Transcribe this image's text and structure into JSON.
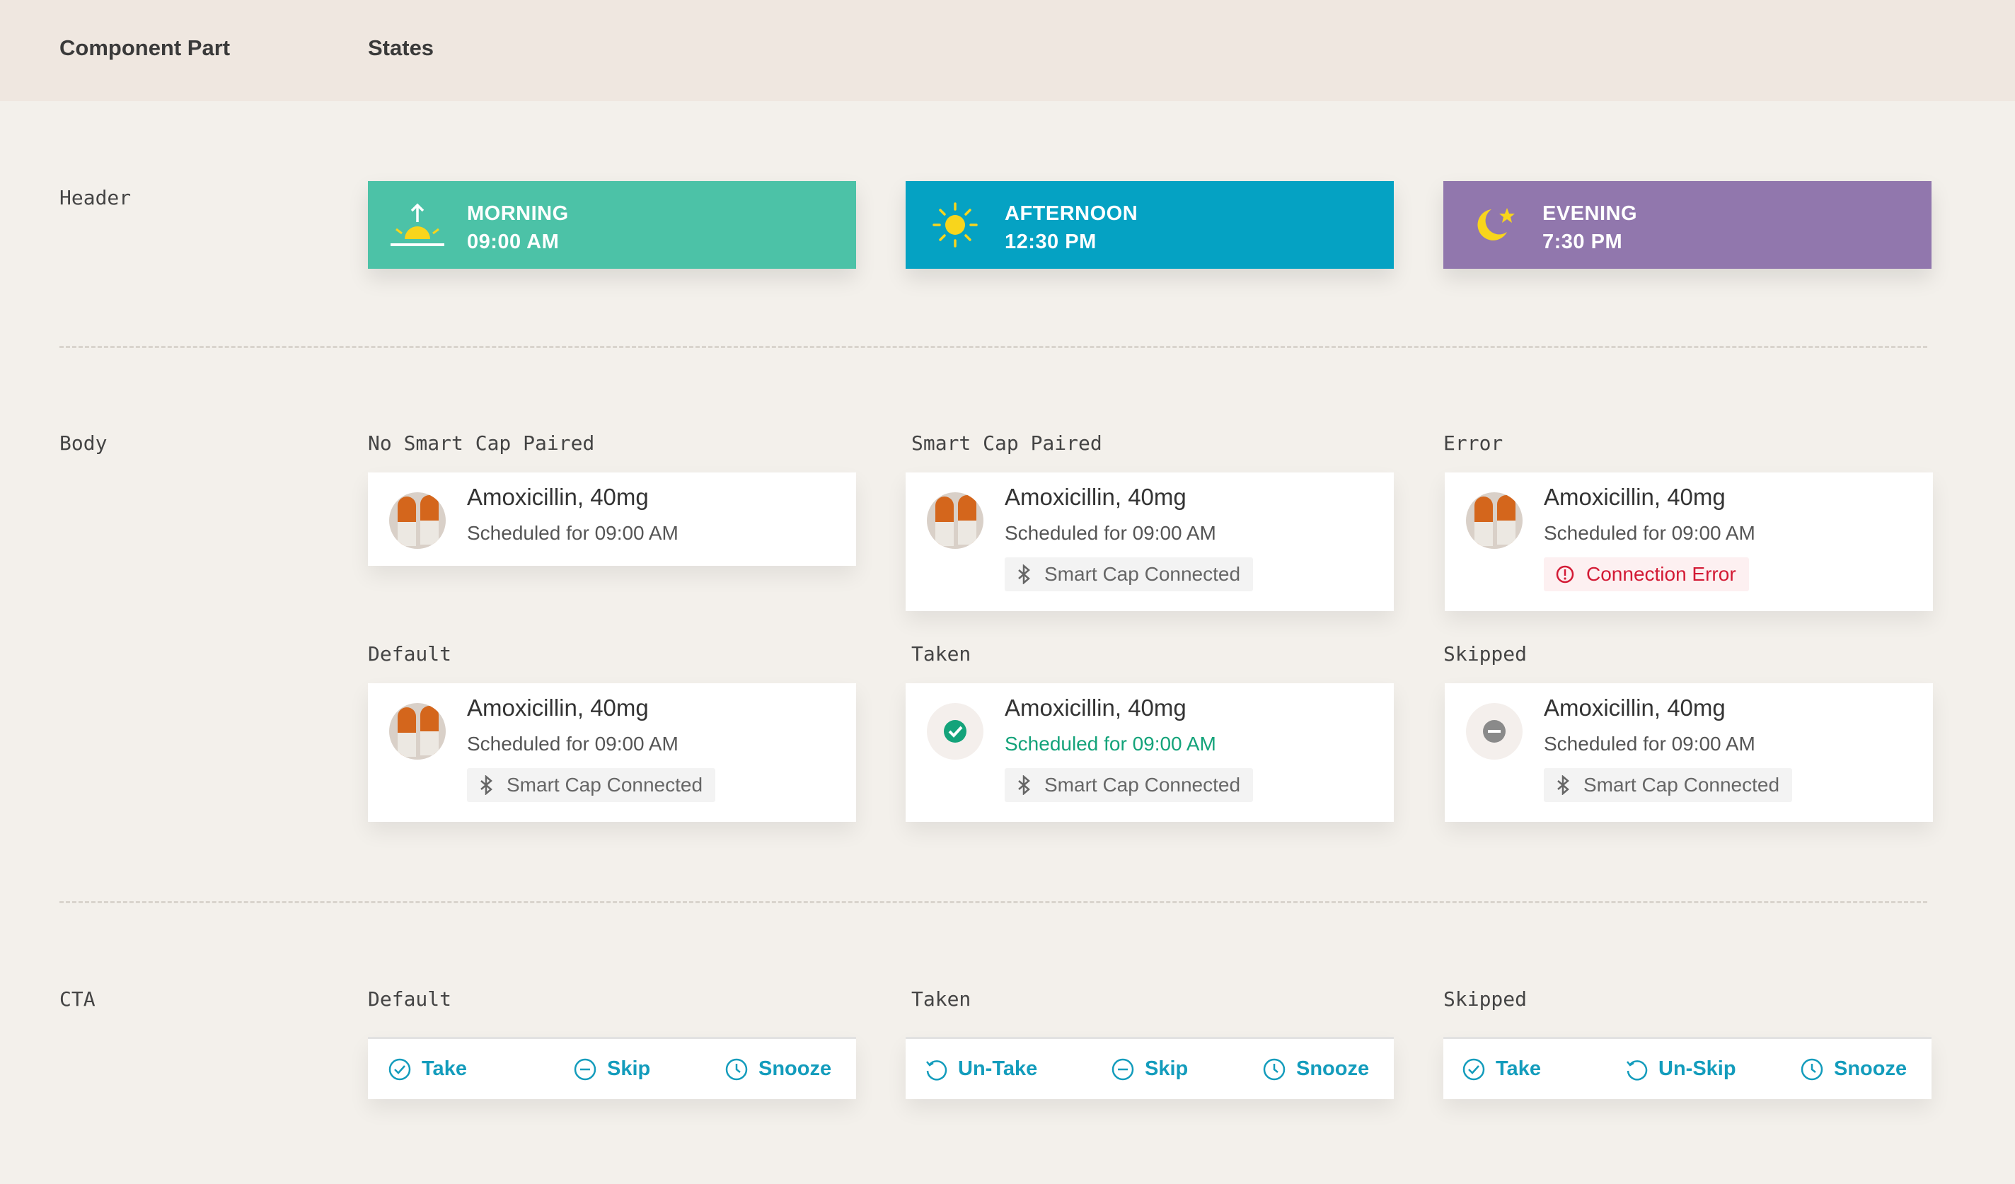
{
  "table_header": {
    "component_part": "Component Part",
    "states": "States"
  },
  "rows": {
    "header": "Header",
    "body": "Body",
    "cta": "CTA"
  },
  "header_states": [
    {
      "period": "MORNING",
      "time": "09:00 AM",
      "color": "#4cc2a7",
      "icon": "sunrise-icon"
    },
    {
      "period": "AFTERNOON",
      "time": "12:30 PM",
      "color": "#05a2c3",
      "icon": "sun-icon"
    },
    {
      "period": "EVENING",
      "time": "7:30 PM",
      "color": "#9177ad",
      "icon": "moon-star-icon"
    }
  ],
  "body_states": {
    "no_cap": {
      "label": "No Smart Cap Paired",
      "name": "Amoxicillin, 40mg",
      "schedule": "Scheduled for 09:00 AM"
    },
    "cap_paired": {
      "label": "Smart Cap Paired",
      "name": "Amoxicillin, 40mg",
      "schedule": "Scheduled for 09:00 AM",
      "tag": "Smart Cap Connected"
    },
    "error": {
      "label": "Error",
      "name": "Amoxicillin, 40mg",
      "schedule": "Scheduled for 09:00 AM",
      "tag": "Connection Error"
    },
    "default": {
      "label": "Default",
      "name": "Amoxicillin, 40mg",
      "schedule": "Scheduled for 09:00 AM",
      "tag": "Smart Cap Connected"
    },
    "taken": {
      "label": "Taken",
      "name": "Amoxicillin, 40mg",
      "schedule": "Scheduled for 09:00 AM",
      "tag": "Smart Cap Connected"
    },
    "skipped": {
      "label": "Skipped",
      "name": "Amoxicillin, 40mg",
      "schedule": "Scheduled for 09:00 AM",
      "tag": "Smart Cap Connected"
    }
  },
  "cta_states": {
    "default": {
      "label": "Default",
      "b1": "Take",
      "b2": "Skip",
      "b3": "Snooze"
    },
    "taken": {
      "label": "Taken",
      "b1": "Un-Take",
      "b2": "Skip",
      "b3": "Snooze"
    },
    "skipped": {
      "label": "Skipped",
      "b1": "Take",
      "b2": "Un-Skip",
      "b3": "Snooze"
    }
  },
  "colors": {
    "accent": "#139cbc",
    "success": "#14a37a",
    "error": "#d31a35"
  }
}
